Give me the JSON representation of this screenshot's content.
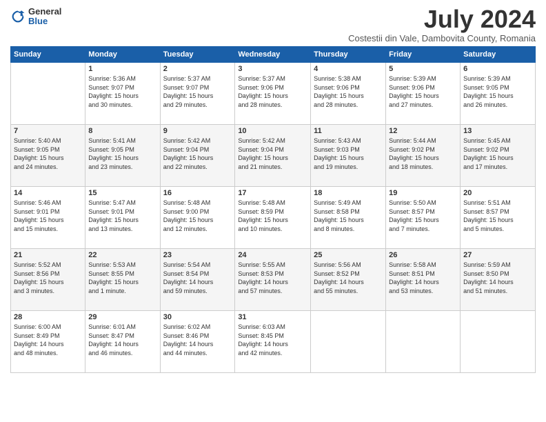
{
  "logo": {
    "general": "General",
    "blue": "Blue"
  },
  "header": {
    "month": "July 2024",
    "location": "Costestii din Vale, Dambovita County, Romania"
  },
  "weekdays": [
    "Sunday",
    "Monday",
    "Tuesday",
    "Wednesday",
    "Thursday",
    "Friday",
    "Saturday"
  ],
  "weeks": [
    [
      {
        "day": "",
        "info": ""
      },
      {
        "day": "1",
        "info": "Sunrise: 5:36 AM\nSunset: 9:07 PM\nDaylight: 15 hours\nand 30 minutes."
      },
      {
        "day": "2",
        "info": "Sunrise: 5:37 AM\nSunset: 9:07 PM\nDaylight: 15 hours\nand 29 minutes."
      },
      {
        "day": "3",
        "info": "Sunrise: 5:37 AM\nSunset: 9:06 PM\nDaylight: 15 hours\nand 28 minutes."
      },
      {
        "day": "4",
        "info": "Sunrise: 5:38 AM\nSunset: 9:06 PM\nDaylight: 15 hours\nand 28 minutes."
      },
      {
        "day": "5",
        "info": "Sunrise: 5:39 AM\nSunset: 9:06 PM\nDaylight: 15 hours\nand 27 minutes."
      },
      {
        "day": "6",
        "info": "Sunrise: 5:39 AM\nSunset: 9:05 PM\nDaylight: 15 hours\nand 26 minutes."
      }
    ],
    [
      {
        "day": "7",
        "info": "Sunrise: 5:40 AM\nSunset: 9:05 PM\nDaylight: 15 hours\nand 24 minutes."
      },
      {
        "day": "8",
        "info": "Sunrise: 5:41 AM\nSunset: 9:05 PM\nDaylight: 15 hours\nand 23 minutes."
      },
      {
        "day": "9",
        "info": "Sunrise: 5:42 AM\nSunset: 9:04 PM\nDaylight: 15 hours\nand 22 minutes."
      },
      {
        "day": "10",
        "info": "Sunrise: 5:42 AM\nSunset: 9:04 PM\nDaylight: 15 hours\nand 21 minutes."
      },
      {
        "day": "11",
        "info": "Sunrise: 5:43 AM\nSunset: 9:03 PM\nDaylight: 15 hours\nand 19 minutes."
      },
      {
        "day": "12",
        "info": "Sunrise: 5:44 AM\nSunset: 9:02 PM\nDaylight: 15 hours\nand 18 minutes."
      },
      {
        "day": "13",
        "info": "Sunrise: 5:45 AM\nSunset: 9:02 PM\nDaylight: 15 hours\nand 17 minutes."
      }
    ],
    [
      {
        "day": "14",
        "info": "Sunrise: 5:46 AM\nSunset: 9:01 PM\nDaylight: 15 hours\nand 15 minutes."
      },
      {
        "day": "15",
        "info": "Sunrise: 5:47 AM\nSunset: 9:01 PM\nDaylight: 15 hours\nand 13 minutes."
      },
      {
        "day": "16",
        "info": "Sunrise: 5:48 AM\nSunset: 9:00 PM\nDaylight: 15 hours\nand 12 minutes."
      },
      {
        "day": "17",
        "info": "Sunrise: 5:48 AM\nSunset: 8:59 PM\nDaylight: 15 hours\nand 10 minutes."
      },
      {
        "day": "18",
        "info": "Sunrise: 5:49 AM\nSunset: 8:58 PM\nDaylight: 15 hours\nand 8 minutes."
      },
      {
        "day": "19",
        "info": "Sunrise: 5:50 AM\nSunset: 8:57 PM\nDaylight: 15 hours\nand 7 minutes."
      },
      {
        "day": "20",
        "info": "Sunrise: 5:51 AM\nSunset: 8:57 PM\nDaylight: 15 hours\nand 5 minutes."
      }
    ],
    [
      {
        "day": "21",
        "info": "Sunrise: 5:52 AM\nSunset: 8:56 PM\nDaylight: 15 hours\nand 3 minutes."
      },
      {
        "day": "22",
        "info": "Sunrise: 5:53 AM\nSunset: 8:55 PM\nDaylight: 15 hours\nand 1 minute."
      },
      {
        "day": "23",
        "info": "Sunrise: 5:54 AM\nSunset: 8:54 PM\nDaylight: 14 hours\nand 59 minutes."
      },
      {
        "day": "24",
        "info": "Sunrise: 5:55 AM\nSunset: 8:53 PM\nDaylight: 14 hours\nand 57 minutes."
      },
      {
        "day": "25",
        "info": "Sunrise: 5:56 AM\nSunset: 8:52 PM\nDaylight: 14 hours\nand 55 minutes."
      },
      {
        "day": "26",
        "info": "Sunrise: 5:58 AM\nSunset: 8:51 PM\nDaylight: 14 hours\nand 53 minutes."
      },
      {
        "day": "27",
        "info": "Sunrise: 5:59 AM\nSunset: 8:50 PM\nDaylight: 14 hours\nand 51 minutes."
      }
    ],
    [
      {
        "day": "28",
        "info": "Sunrise: 6:00 AM\nSunset: 8:49 PM\nDaylight: 14 hours\nand 48 minutes."
      },
      {
        "day": "29",
        "info": "Sunrise: 6:01 AM\nSunset: 8:47 PM\nDaylight: 14 hours\nand 46 minutes."
      },
      {
        "day": "30",
        "info": "Sunrise: 6:02 AM\nSunset: 8:46 PM\nDaylight: 14 hours\nand 44 minutes."
      },
      {
        "day": "31",
        "info": "Sunrise: 6:03 AM\nSunset: 8:45 PM\nDaylight: 14 hours\nand 42 minutes."
      },
      {
        "day": "",
        "info": ""
      },
      {
        "day": "",
        "info": ""
      },
      {
        "day": "",
        "info": ""
      }
    ]
  ]
}
